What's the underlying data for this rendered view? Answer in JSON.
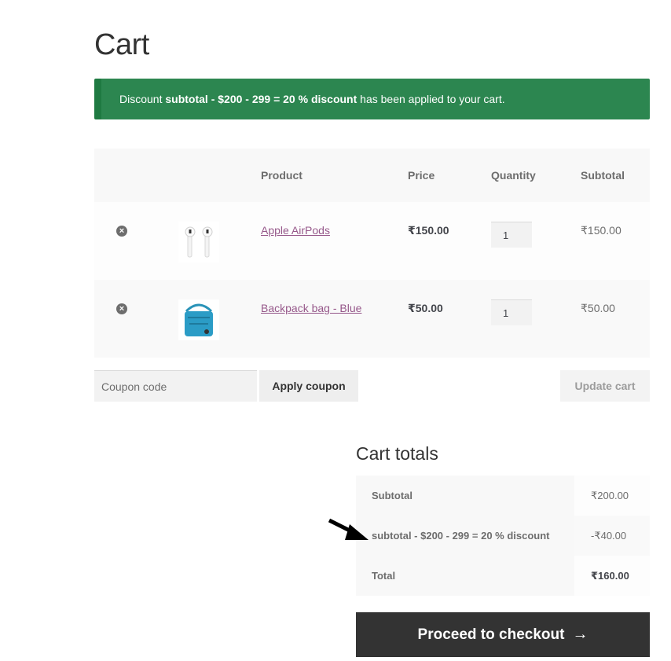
{
  "page": {
    "title": "Cart"
  },
  "notice": {
    "prefix": "Discount ",
    "coupon": "subtotal - $200 - 299 = 20 % discount",
    "suffix": " has been applied to your cart.",
    "color": "#2c8650"
  },
  "cart": {
    "headers": {
      "product": "Product",
      "price": "Price",
      "quantity": "Quantity",
      "subtotal": "Subtotal"
    },
    "items": [
      {
        "remove_icon": "remove-circle-icon",
        "thumbnail": "airpods-image",
        "name": "Apple AirPods",
        "price": "₹150.00",
        "quantity": "1",
        "subtotal": "₹150.00"
      },
      {
        "remove_icon": "remove-circle-icon",
        "thumbnail": "backpack-image",
        "name": "Backpack bag - Blue",
        "price": "₹50.00",
        "quantity": "1",
        "subtotal": "₹50.00"
      }
    ],
    "link_color": "#96588a"
  },
  "coupon": {
    "placeholder": "Coupon code",
    "value": "",
    "apply_label": "Apply coupon"
  },
  "update_label": "Update cart",
  "totals": {
    "title": "Cart totals",
    "rows": [
      {
        "label": "Subtotal",
        "value": "₹200.00"
      },
      {
        "label": "subtotal - $200 - 299 = 20 % discount",
        "value": "-₹40.00"
      },
      {
        "label": "Total",
        "value": "₹160.00"
      }
    ]
  },
  "checkout": {
    "label": "Proceed to checkout",
    "icon": "→"
  }
}
